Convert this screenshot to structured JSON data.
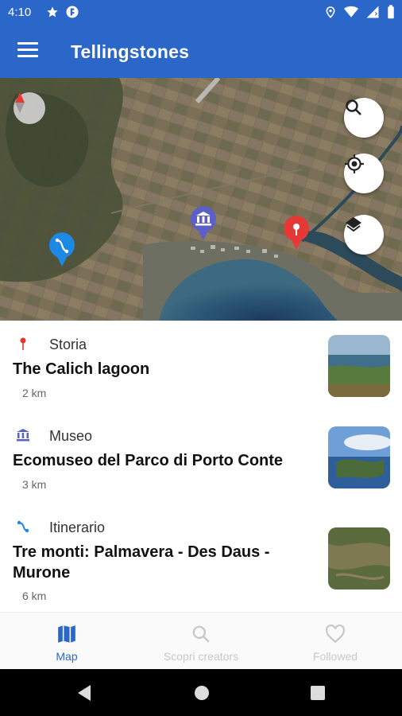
{
  "status_bar": {
    "time": "4:10"
  },
  "app_bar": {
    "title": "Tellingstones"
  },
  "map": {
    "controls": [
      "search-icon",
      "my-location-icon",
      "layers-icon",
      "compass-icon"
    ],
    "markers": [
      "itinerary-pin",
      "museum-pin",
      "story-pin"
    ]
  },
  "places": [
    {
      "category": "Storia",
      "name": "The Calich lagoon",
      "distance": "2 km",
      "category_color": "#e53935"
    },
    {
      "category": "Museo",
      "name": "Ecomuseo del Parco di Porto Conte",
      "distance": "3 km",
      "category_color": "#5c5fc7"
    },
    {
      "category": "Itinerario",
      "name": "Tre monti: Palmavera - Des Daus - Murone",
      "distance": "6 km",
      "category_color": "#1e88e5"
    }
  ],
  "bottom_nav": [
    {
      "label": "Map",
      "active": true
    },
    {
      "label": "Scopri creators",
      "active": false
    },
    {
      "label": "Followed",
      "active": false
    }
  ],
  "colors": {
    "primary": "#2a67c9",
    "inactive": "#c8c8c8"
  }
}
